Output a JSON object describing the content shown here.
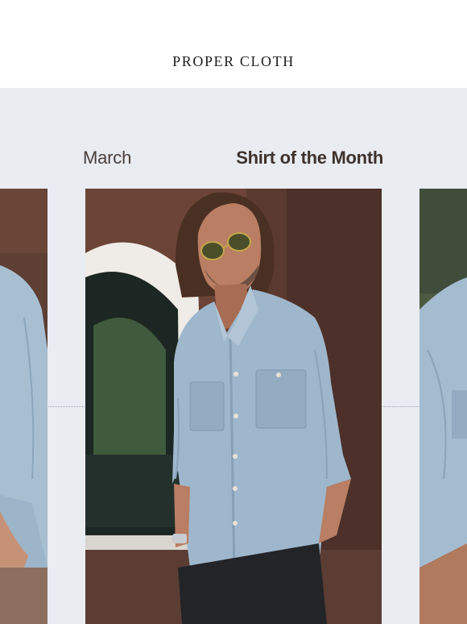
{
  "header": {
    "brand": "PROPER CLOTH"
  },
  "hero": {
    "month": "March",
    "headline": "Shirt of the Month",
    "photos": [
      {
        "subject": "left-partial-photo"
      },
      {
        "subject": "model-in-chambray-shirt-photo"
      },
      {
        "subject": "right-partial-photo"
      }
    ]
  },
  "colors": {
    "background": "#e9ecf1",
    "text": "#3e322d",
    "shirt": "#9fb7cc"
  }
}
